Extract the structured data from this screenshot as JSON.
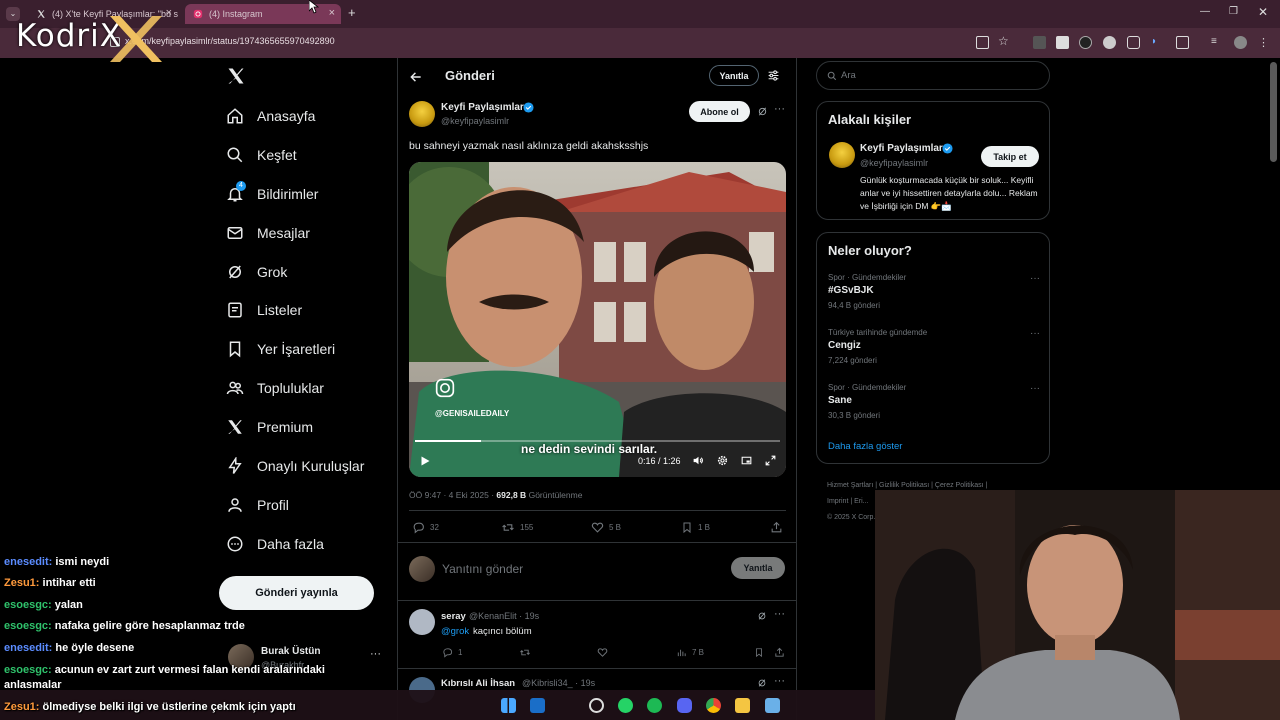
{
  "browser": {
    "tabs": [
      {
        "label": "(4) X'te Keyfi Paylaşımlar: \"bu s...",
        "active": false
      },
      {
        "label": "(4) Instagram",
        "active": true
      }
    ],
    "new_tab_label": "+",
    "url": "x.com/keyfipaylasimlr/status/1974365655970492890"
  },
  "stream_logo": "KodriX",
  "nav": {
    "logo_icon": "x-logo-icon",
    "items": [
      {
        "label": "Anasayfa",
        "icon": "home-icon"
      },
      {
        "label": "Keşfet",
        "icon": "search-icon"
      },
      {
        "label": "Bildirimler",
        "icon": "bell-icon",
        "badge": "4"
      },
      {
        "label": "Mesajlar",
        "icon": "mail-icon"
      },
      {
        "label": "Grok",
        "icon": "grok-icon"
      },
      {
        "label": "Listeler",
        "icon": "list-icon"
      },
      {
        "label": "Yer İşaretleri",
        "icon": "bookmark-icon"
      },
      {
        "label": "Topluluklar",
        "icon": "people-icon"
      },
      {
        "label": "Premium",
        "icon": "x-logo-icon"
      },
      {
        "label": "Onaylı Kuruluşlar",
        "icon": "lightning-icon"
      },
      {
        "label": "Profil",
        "icon": "user-icon"
      },
      {
        "label": "Daha fazla",
        "icon": "more-circle-icon"
      }
    ],
    "post_button": "Gönderi yayınla",
    "account": {
      "name": "Burak Üstün",
      "handle": "@Burakhfr..."
    }
  },
  "center": {
    "header_title": "Gönderi",
    "reply_button": "Yanıtla",
    "tweet": {
      "author": "Keyfi Paylaşımlar",
      "handle": "@keyfipaylasimlr",
      "subscribe_button": "Abone ol",
      "text": "bu sahneyi yazmak nasıl aklınıza geldi akahsksshjs",
      "video": {
        "watermark": "@GENISAILEDAILY",
        "subtitle": "ne dedin sevindi sarılar.",
        "time": "0:16 / 1:26",
        "progress": 0.18
      },
      "timestamp": "ÖÖ 9:47 · 4 Eki 2025 ·",
      "views": "692,8 B",
      "views_label": "Görüntülenme",
      "stats": {
        "replies": "32",
        "retweets": "155",
        "likes": "5 B",
        "bookmarks": "1 B"
      }
    },
    "reply_box": {
      "placeholder": "Yanıtını gönder",
      "button": "Yanıtla"
    },
    "replies": [
      {
        "name": "seray",
        "handle": "@KenanElit · 19s",
        "mention": "@grok",
        "text": "kaçıncı bölüm",
        "replies": "1",
        "views": "7 B"
      },
      {
        "name": "Kıbrıslı Ali İhsan",
        "handle": "@Kibrisli34_ · 19s"
      }
    ]
  },
  "right": {
    "search_placeholder": "Ara",
    "related": {
      "title": "Alakalı kişiler",
      "name": "Keyfi Paylaşımlar",
      "handle": "@keyfipaylasimlr",
      "follow_button": "Takip et",
      "bio": "Günlük koşturmacada küçük bir soluk... Keyifli anlar ve iyi hissettiren detaylarla dolu... Reklam ve İşbirliği için DM 👉📩"
    },
    "trends": {
      "title": "Neler oluyor?",
      "items": [
        {
          "meta": "Spor · Gündemdekiler",
          "name": "#GSvBJK",
          "count": "94,4 B gönderi"
        },
        {
          "meta": "Türkiye tarihinde gündemde",
          "name": "Cengiz",
          "count": "7,224 gönderi"
        },
        {
          "meta": "Spor · Gündemdekiler",
          "name": "Sane",
          "count": "30,3 B gönderi"
        }
      ],
      "show_more": "Daha fazla göster"
    },
    "footer": {
      "links": [
        "Hizmet Şartları",
        "Gizlilik Politikası",
        "Çerez Politikası",
        "Imprint",
        "Eri..."
      ],
      "copyright": "© 2025 X Corp."
    }
  },
  "chat": [
    {
      "user": "enesedit:",
      "msg": "ismi neydi",
      "color": "#5b8cff"
    },
    {
      "user": "Zesu1:",
      "msg": "intihar etti",
      "color": "#ff9a3c"
    },
    {
      "user": "esoesgc:",
      "msg": "yalan",
      "color": "#2fc26b"
    },
    {
      "user": "esoesgc:",
      "msg": "nafaka gelire göre hesaplanmaz trde",
      "color": "#2fc26b"
    },
    {
      "user": "enesedit:",
      "msg": "he öyle desene",
      "color": "#5b8cff"
    },
    {
      "user": "esoesgc:",
      "msg": "acunun ev zart zurt vermesi falan kendi aralarındaki",
      "color": "#2fc26b"
    },
    {
      "user": "",
      "msg": "anlasmalar",
      "color": "#2fc26b"
    },
    {
      "user": "Zesu1:",
      "msg": "ölmediyse belki ilgi ve üstlerine çekmk için yaptı",
      "color": "#ff9a3c"
    }
  ],
  "colors": {
    "accent": "#1d9bf0",
    "verified": "#1d9bf0",
    "tab_bar": "#3a1f2e"
  }
}
